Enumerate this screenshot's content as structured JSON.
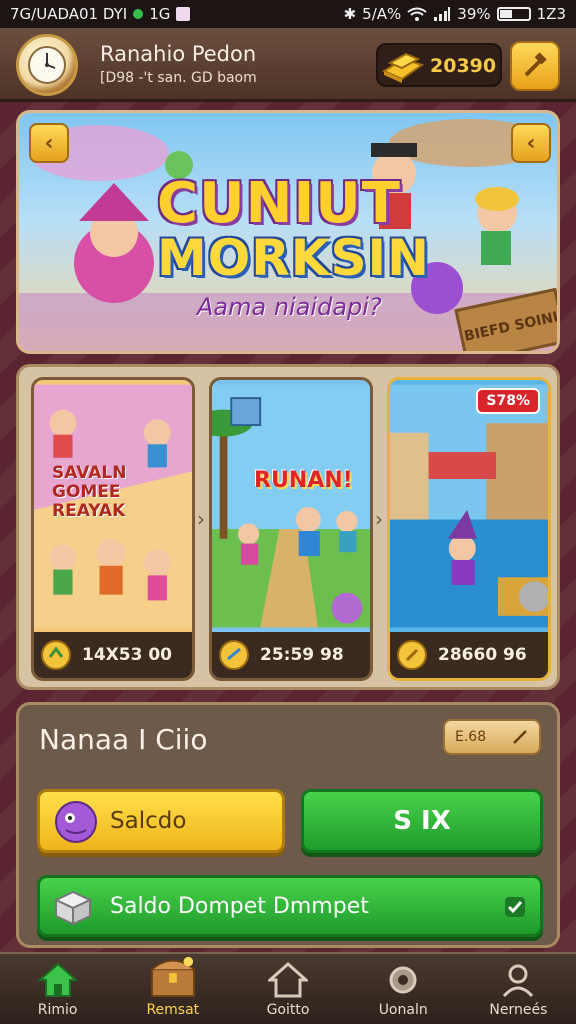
{
  "status_bar": {
    "left_text": "7G/UADA01 DYI",
    "mid_text": "1G",
    "right_text": "5/A%",
    "battery_text": "39%",
    "time": "1Z3"
  },
  "header": {
    "player_name": "Ranahio Pedon",
    "player_sub": "[D98 -'t san. GD baom",
    "coin_value": "20390"
  },
  "banner": {
    "title_line1": "CUNIUT",
    "title_line2": "MORKSIN",
    "subtitle": "Aama niaidapi?",
    "sign_text": "BIEFD SOINI"
  },
  "cards": [
    {
      "label": "SAVALN GOMEE REAYAK",
      "price": "14X53 00"
    },
    {
      "label": "RUNAN!",
      "price": "25:59 98"
    },
    {
      "label": "",
      "price": "28660 96",
      "badge": "S78%"
    }
  ],
  "bottom_panel": {
    "title": "Nanaa I Ciio",
    "mini_button": "E.68",
    "yellow_button": "Salcdo",
    "green_button": "S IX",
    "wide_button": "Saldo Dompet Dmmpet"
  },
  "nav": [
    {
      "label": "Rimio",
      "icon": "home-icon"
    },
    {
      "label": "Remsat",
      "icon": "treasure-chest-icon"
    },
    {
      "label": "Goitto",
      "icon": "house-icon"
    },
    {
      "label": "Uonaln",
      "icon": "gear-icon"
    },
    {
      "label": "Nerneés",
      "icon": "profile-icon"
    }
  ],
  "colors": {
    "accent_gold": "#f7c948",
    "green": "#2fb33a",
    "badge_red": "#d8242b"
  }
}
